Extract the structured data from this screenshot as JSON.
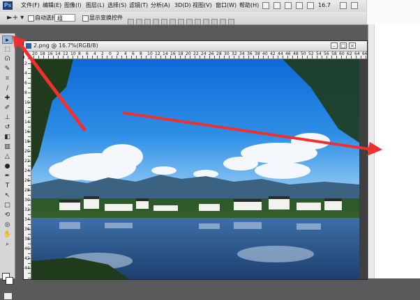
{
  "app": {
    "logo": "Ps"
  },
  "menubar": {
    "items": [
      "文件(F)",
      "编辑(E)",
      "图像(I)",
      "图层(L)",
      "选择(S)",
      "滤镜(T)",
      "分析(A)",
      "3D(D)",
      "视图(V)",
      "窗口(W)",
      "帮助(H)"
    ],
    "zoom": "16.7"
  },
  "options_bar": {
    "auto_select_label": "自动选择:",
    "auto_select_value": "组",
    "show_transform_label": "显示变换控件"
  },
  "document": {
    "title": "2.png @ 16.7%(RGB/8)",
    "ruler_top": [
      "20",
      "18",
      "16",
      "14",
      "12",
      "10",
      "8",
      "6",
      "4",
      "2",
      "0",
      "2",
      "4",
      "6",
      "8",
      "10",
      "12",
      "14",
      "16",
      "18",
      "20",
      "22",
      "24",
      "26",
      "28",
      "30",
      "32",
      "34",
      "36",
      "38",
      "40",
      "42",
      "44",
      "46",
      "48",
      "50",
      "52",
      "54",
      "56",
      "58",
      "60",
      "62",
      "64",
      "66",
      "68",
      "70"
    ],
    "ruler_left": [
      "2",
      "4",
      "6",
      "8",
      "10",
      "12",
      "14",
      "16",
      "18",
      "20",
      "22",
      "24",
      "26",
      "28",
      "30",
      "32",
      "34",
      "36",
      "38",
      "40",
      "42",
      "44"
    ]
  },
  "colors": {
    "arrow": "#f0302f",
    "sky_top": "#0d6ad8",
    "sky_bottom": "#58b0ee"
  }
}
